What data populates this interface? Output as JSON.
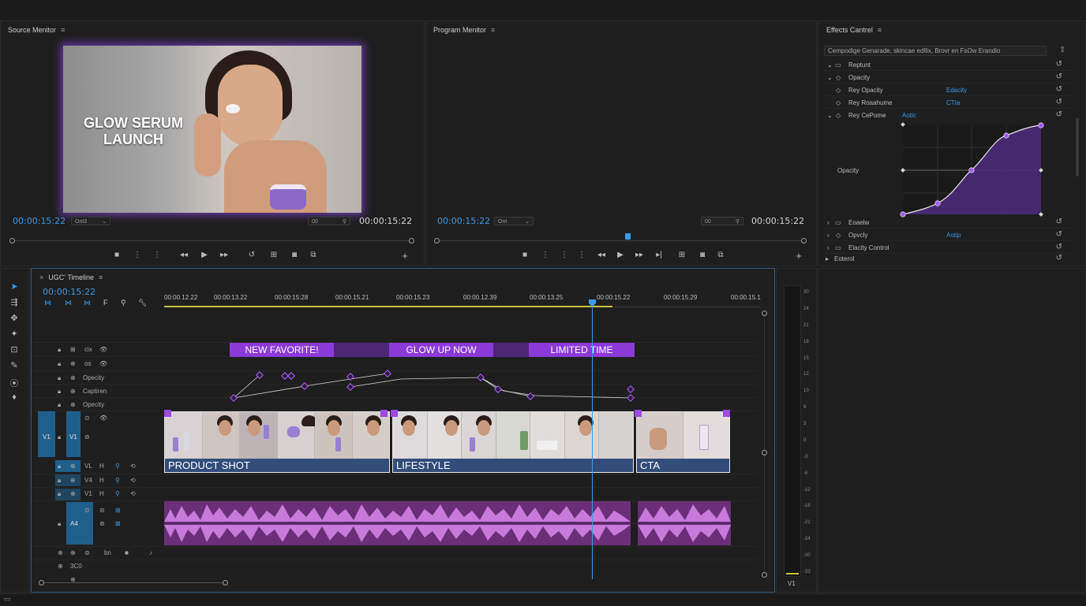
{
  "source_monitor": {
    "title": "Source Menitor",
    "overlay_line1": "GLOW SERUM",
    "overlay_line2": "LAUNCH",
    "timecode_in": "00:00:15:22",
    "dropdown": "Ont3",
    "zoom": "00",
    "timecode_out": "00:00:15:22"
  },
  "program_monitor": {
    "title": "Program Menitor",
    "timecode_in": "00:00:15:22",
    "dropdown": "Ont",
    "zoom": "00",
    "timecode_out": "00:00:15:22"
  },
  "effects_control": {
    "title": "Effects Cantrel",
    "clip_label": "Cempodige Genarade, skincae edllix, Brovr en FsOw Erandio",
    "rows": [
      {
        "label": "Reptunt",
        "value": ""
      },
      {
        "label": "Opacity",
        "value": ""
      },
      {
        "label": "Rey Opacity",
        "value": "Edacity"
      },
      {
        "label": "Rey Roaahume",
        "value": "CTIa"
      },
      {
        "label": "Rey CePome",
        "value": "Aotic"
      }
    ],
    "graph_label": "Opacity",
    "bottom_rows": [
      {
        "label": "Eoaelw",
        "value": ""
      },
      {
        "label": "Opvcly",
        "value": "Aotip"
      },
      {
        "label": "Elacity Control",
        "value": ""
      },
      {
        "label": "Eoterol",
        "value": ""
      }
    ],
    "accent_color": "#8b3ad8"
  },
  "timeline": {
    "title": "UGC' Timeline",
    "timecode": "00:00:15:22",
    "ruler_ticks": [
      "00:00.12.22",
      "00:00:13.22",
      "00:00:15:28",
      "00:00.15.21",
      "00:00:15.23",
      "00:00.12.39",
      "00:00:13.25",
      "00:00:15.22",
      "00:00:15.29",
      "00:00.15.1"
    ],
    "track_labels": {
      "ctx": "cix",
      "os": "os",
      "opacity1": "Opecity",
      "caption": "Captiren",
      "opacity2": "Opecity",
      "v1a": "V1",
      "v1b": "V1",
      "vl": "VL",
      "v4": "V4",
      "v1c": "V1",
      "a4": "A4",
      "misc": "3C0",
      "bn": "bn"
    },
    "banners": [
      "NEW FAVORITE!",
      "GLOW UP NOW",
      "LIMITED TIME"
    ],
    "clips": [
      "PRODUCT SHOT",
      "LIFESTYLE",
      "CTA"
    ],
    "playhead_color": "#3a9bea",
    "clip_bar_color": "#334d7a",
    "audio_color": "#c77ad9"
  },
  "meter": {
    "labels": [
      "30",
      "24",
      "21",
      "18",
      "15",
      "12",
      "10",
      "6",
      "3",
      "0",
      "-3",
      "-6",
      "-12",
      "-18",
      "-21",
      "-24",
      "-30",
      "-33"
    ],
    "bottom": "V1"
  }
}
